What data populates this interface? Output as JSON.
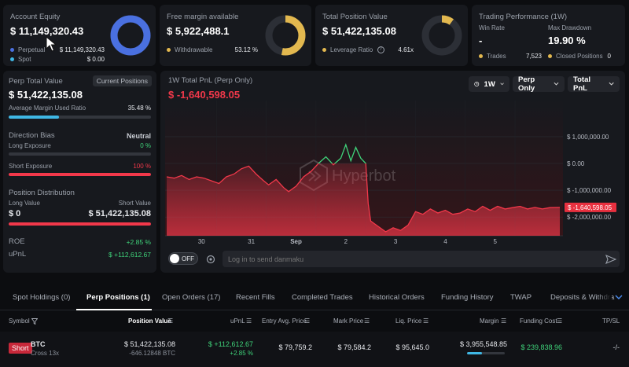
{
  "colors": {
    "accent_green": "#3fd37a",
    "accent_red": "#f2384a",
    "blue": "#4a70e0",
    "gold": "#e2b84f",
    "cyan": "#3fb7e4"
  },
  "account_equity": {
    "label": "Account Equity",
    "value": "$ 11,149,320.43",
    "perpetual_label": "Perpetual",
    "perpetual_value": "$ 11,149,320.43",
    "spot_label": "Spot",
    "spot_value": "$ 0.00",
    "perpetual_share": 1.0
  },
  "free_margin": {
    "label": "Free margin available",
    "value": "$ 5,922,488.1",
    "withdrawable_label": "Withdrawable",
    "withdrawable_value": "53.12 %",
    "share": 0.5312
  },
  "total_position": {
    "label": "Total Position Value",
    "value": "$ 51,422,135.08",
    "leverage_label": "Leverage Ratio",
    "leverage_value": "4.61x",
    "share": 0.1
  },
  "trading_performance": {
    "label": "Trading Performance (1W)",
    "win_rate_label": "Win Rate",
    "win_rate_value": "-",
    "max_drawdown_label": "Max Drawdown",
    "max_drawdown_value": "19.90 %",
    "trades_label": "Trades",
    "trades_value": "7,523",
    "closed_label": "Closed Positions",
    "closed_value": "0"
  },
  "perp_panel": {
    "title": "Perp Total Value",
    "current_positions_button": "Current Positions",
    "value": "$ 51,422,135.08",
    "margin_label": "Average Margin Used Ratio",
    "margin_value": "35.48 %",
    "margin_ratio": 0.3548,
    "bias_label": "Direction Bias",
    "bias_value": "Neutral",
    "long_exposure_label": "Long Exposure",
    "long_exposure_value": "0 %",
    "short_exposure_label": "Short Exposure",
    "short_exposure_value": "100 %",
    "short_ratio": 1.0,
    "distribution_label": "Position Distribution",
    "long_value_label": "Long Value",
    "short_value_label": "Short Value",
    "long_value": "$ 0",
    "short_value": "$ 51,422,135.08",
    "roe_label": "ROE",
    "roe_value": "+2.85 %",
    "upnl_label": "uPnL",
    "upnl_value": "$ +112,612.67"
  },
  "chart_panel": {
    "title": "1W Total PnL (Perp Only)",
    "value": "$ -1,640,598.05",
    "timeframe": "1W",
    "scope": "Perp Only",
    "metric": "Total PnL",
    "watermark": "Hyperbot",
    "off_label": "OFF",
    "danmaku_placeholder": "Log in to send danmaku"
  },
  "chart_data": {
    "type": "area",
    "title": "",
    "xlabel": "",
    "ylabel": "",
    "x_ticks": [
      "30",
      "31",
      "Sep",
      "2",
      "3",
      "4",
      "5"
    ],
    "y_ticks": [
      "$ 1,000,000.00",
      "$ 0.00",
      "$ -1,000,000.00",
      "$ -2,000,000.00"
    ],
    "y_tick_values": [
      1000000,
      0,
      -1000000,
      -2000000
    ],
    "ylim": [
      -2700000,
      2200000
    ],
    "current_label": "$ -1,640,598.05",
    "x_domain": [
      0,
      7.9
    ],
    "x": [
      0.0,
      0.15,
      0.3,
      0.45,
      0.6,
      0.75,
      0.9,
      1.05,
      1.2,
      1.35,
      1.5,
      1.65,
      1.8,
      1.95,
      2.05,
      2.2,
      2.35,
      2.45,
      2.6,
      2.75,
      2.9,
      3.05,
      3.2,
      3.35,
      3.5,
      3.6,
      3.7,
      3.8,
      3.9,
      4.0,
      4.05,
      4.1,
      4.25,
      4.4,
      4.55,
      4.7,
      4.85,
      5.0,
      5.15,
      5.3,
      5.45,
      5.6,
      5.75,
      5.9,
      6.05,
      6.2,
      6.35,
      6.5,
      6.65,
      6.8,
      6.95,
      7.1,
      7.25,
      7.4,
      7.55,
      7.7,
      7.9
    ],
    "values": [
      -500000,
      -550000,
      -450000,
      -600000,
      -500000,
      -550000,
      -650000,
      -750000,
      -500000,
      -400000,
      -200000,
      -100000,
      -400000,
      -650000,
      -800000,
      -600000,
      -900000,
      -1050000,
      -850000,
      -500000,
      -300000,
      0,
      250000,
      -50000,
      200000,
      700000,
      100000,
      600000,
      200000,
      0,
      -1500000,
      -2150000,
      -2350000,
      -2550000,
      -2400000,
      -2500000,
      -2300000,
      -1800000,
      -1900000,
      -1700000,
      -1850000,
      -1750000,
      -1900000,
      -1850000,
      -1700000,
      -1800000,
      -1600000,
      -1750000,
      -1600000,
      -1700000,
      -1650000,
      -1600000,
      -1700000,
      -1640598,
      -1700000,
      -1650000,
      -1640598
    ],
    "grid": true
  },
  "bottom_tabs": [
    "Spot Holdings (0)",
    "Perp Positions (1)",
    "Open Orders (17)",
    "Recent Fills",
    "Completed Trades",
    "Historical Orders",
    "Funding History",
    "TWAP",
    "Deposits & Withdra"
  ],
  "table": {
    "headers": [
      "Symbol",
      "Position Value",
      "uPnL",
      "Entry Avg. Price",
      "Mark Price",
      "Liq. Price",
      "Margin",
      "Funding Cost",
      "TP/SL"
    ],
    "row": {
      "side": "Short",
      "symbol": "BTC",
      "margin_mode": "Cross 13x",
      "position_value": "$ 51,422,135.08",
      "position_size": "-646.12848 BTC",
      "upnl": "$ +112,612.67",
      "upnl_pct": "+2.85 %",
      "entry": "$ 79,759.2",
      "mark": "$ 79,584.2",
      "liq": "$ 95,645.0",
      "margin": "$ 3,955,548.85",
      "margin_ratio": 0.4,
      "funding": "$ 239,838.96",
      "tpsl": "-/-"
    }
  }
}
